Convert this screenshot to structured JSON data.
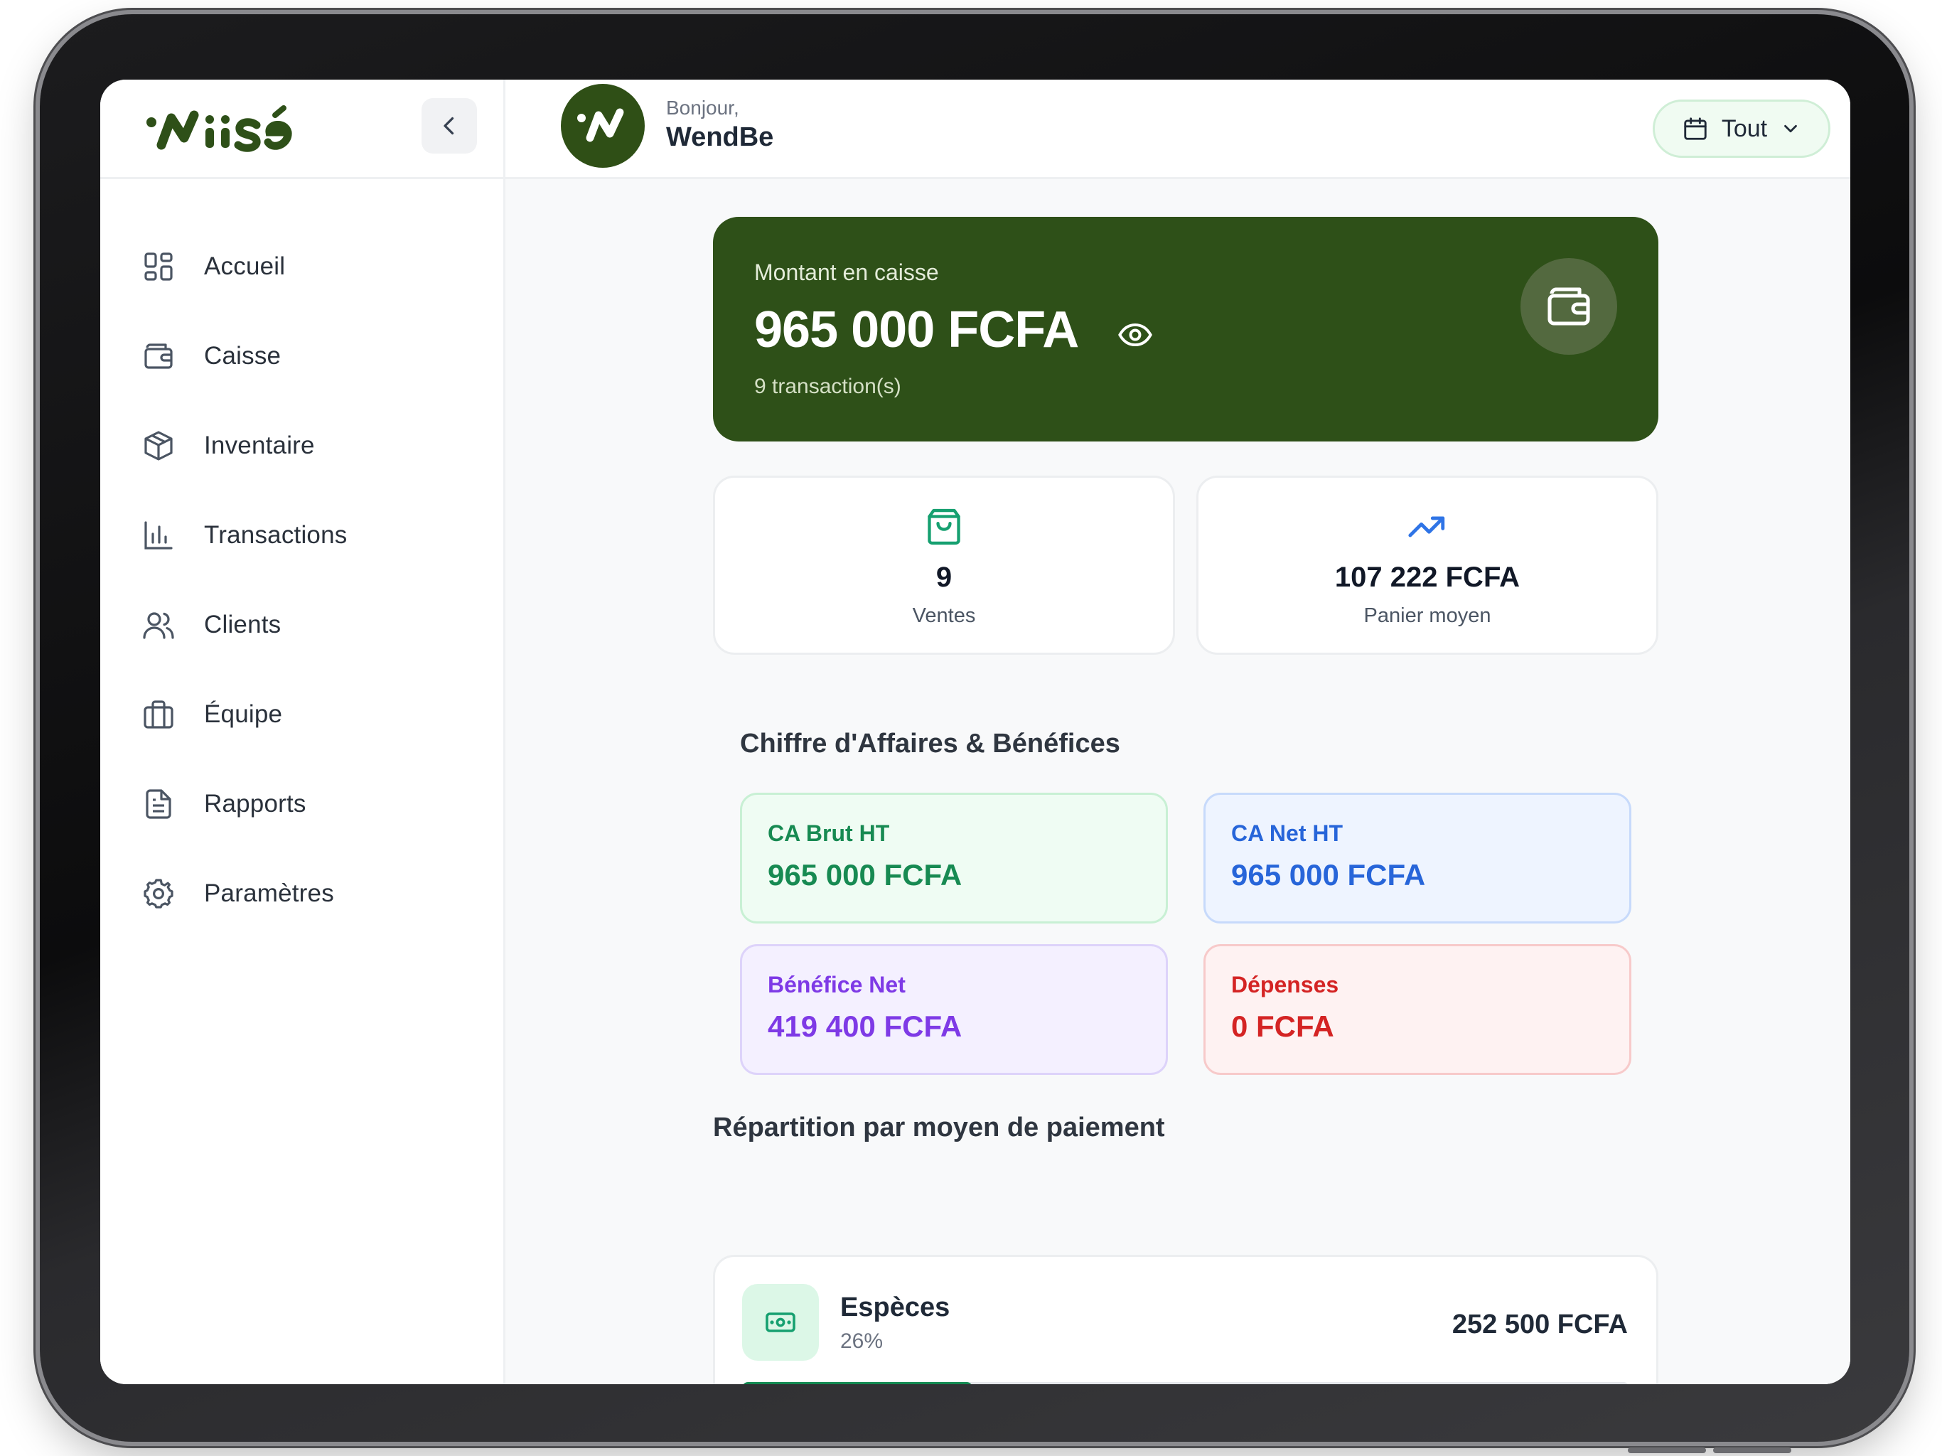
{
  "app": {
    "brand_name": "Niisé"
  },
  "sidebar": {
    "collapse_icon": "chevron-left-icon",
    "items": [
      {
        "label": "Accueil",
        "icon": "grid-icon"
      },
      {
        "label": "Caisse",
        "icon": "wallet-icon"
      },
      {
        "label": "Inventaire",
        "icon": "package-icon"
      },
      {
        "label": "Transactions",
        "icon": "bar-chart-icon"
      },
      {
        "label": "Clients",
        "icon": "users-icon"
      },
      {
        "label": "Équipe",
        "icon": "briefcase-icon"
      },
      {
        "label": "Rapports",
        "icon": "file-text-icon"
      },
      {
        "label": "Paramètres",
        "icon": "gear-icon"
      }
    ]
  },
  "header": {
    "greeting": "Bonjour,",
    "user_name": "WendBe",
    "filter": {
      "label": "Tout",
      "icon": "calendar-icon"
    }
  },
  "cash": {
    "title": "Montant en caisse",
    "amount": "965 000 FCFA",
    "transactions": "9 transaction(s)",
    "icon": "wallet-icon"
  },
  "stats": [
    {
      "value": "9",
      "label": "Ventes",
      "icon": "shopping-bag-icon"
    },
    {
      "value": "107 222 FCFA",
      "label": "Panier moyen",
      "icon": "trending-up-icon"
    }
  ],
  "revenue": {
    "title": "Chiffre d'Affaires & Bénéfices",
    "cards": [
      {
        "label": "CA Brut HT",
        "value": "965 000 FCFA"
      },
      {
        "label": "CA Net HT",
        "value": "965 000 FCFA"
      },
      {
        "label": "Bénéfice Net",
        "value": "419 400 FCFA"
      },
      {
        "label": "Dépenses",
        "value": "0 FCFA"
      }
    ]
  },
  "payments": {
    "title": "Répartition par moyen de paiement",
    "items": [
      {
        "name": "Espèces",
        "percent_label": "26%",
        "share": 0.26,
        "amount": "252 500 FCFA",
        "icon": "banknote-icon"
      }
    ]
  },
  "colors": {
    "brand_dark_green": "#2e5018",
    "accent_green": "#178a52",
    "accent_blue": "#2765d9",
    "accent_purple": "#7e3ae6",
    "accent_red": "#d42424"
  }
}
